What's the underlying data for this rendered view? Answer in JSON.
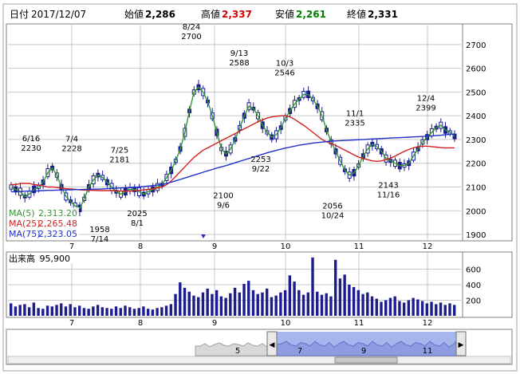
{
  "header": {
    "date_label": "日付",
    "date_value": "2017/12/07",
    "open_label": "始値",
    "open_value": "2,286",
    "high_label": "高値",
    "high_value": "2,337",
    "low_label": "安値",
    "low_value": "2,261",
    "close_label": "終値",
    "close_value": "2,331"
  },
  "legend": {
    "ma5_label": "MA(5)",
    "ma5_value": "2,313.20",
    "ma25_label": "MA(25)",
    "ma25_value": "2,265.48",
    "ma75_label": "MA(75)",
    "ma75_value": "2,323.05"
  },
  "volume": {
    "label": "出来高",
    "value": "95,900"
  },
  "colors": {
    "ma5": "#2e9a2e",
    "ma25": "#d42020",
    "ma75": "#2030c8",
    "candle": "#1c1c8c",
    "high_value": "#d40000",
    "low_value": "#008000",
    "grid": "#c8c8c8",
    "navigator_fill": "#a8b6ee"
  },
  "chart_data": [
    {
      "type": "candlestick",
      "x_axis_labels": [
        "7",
        "8",
        "9",
        "10",
        "11",
        "12"
      ],
      "y_ticks": [
        1900,
        2000,
        2100,
        2200,
        2300,
        2400,
        2500,
        2600,
        2700
      ],
      "ylim": [
        1880,
        2780
      ],
      "annotations": [
        {
          "date": "6/16",
          "value": "2230"
        },
        {
          "date": "7/4",
          "value": "2228"
        },
        {
          "date": "7/25",
          "value": "2181"
        },
        {
          "date": "7/14",
          "value": "1958"
        },
        {
          "date": "8/1",
          "value": "2025"
        },
        {
          "date": "8/24",
          "value": "2700"
        },
        {
          "date": "9/6",
          "value": "2100"
        },
        {
          "date": "9/13",
          "value": "2588"
        },
        {
          "date": "9/22",
          "value": "2253"
        },
        {
          "date": "10/3",
          "value": "2546"
        },
        {
          "date": "10/24",
          "value": "2056"
        },
        {
          "date": "11/1",
          "value": "2335"
        },
        {
          "date": "11/16",
          "value": "2143"
        },
        {
          "date": "12/4",
          "value": "2399"
        }
      ],
      "series": [
        {
          "name": "MA(5)",
          "values": [
            2100,
            2090,
            2080,
            2060,
            2070,
            2090,
            2100,
            2120,
            2160,
            2180,
            2150,
            2100,
            2060,
            2040,
            2020,
            2010,
            2050,
            2100,
            2130,
            2150,
            2140,
            2120,
            2100,
            2080,
            2070,
            2080,
            2090,
            2090,
            2080,
            2070,
            2080,
            2090,
            2100,
            2110,
            2140,
            2170,
            2210,
            2260,
            2330,
            2420,
            2500,
            2520,
            2500,
            2460,
            2400,
            2330,
            2260,
            2240,
            2260,
            2300,
            2350,
            2400,
            2440,
            2430,
            2400,
            2360,
            2330,
            2310,
            2320,
            2350,
            2390,
            2420,
            2450,
            2470,
            2490,
            2490,
            2470,
            2440,
            2400,
            2340,
            2290,
            2250,
            2210,
            2170,
            2150,
            2160,
            2190,
            2230,
            2260,
            2280,
            2270,
            2250,
            2220,
            2210,
            2200,
            2190,
            2190,
            2200,
            2230,
            2260,
            2290,
            2310,
            2330,
            2350,
            2360,
            2340,
            2330,
            2313
          ]
        },
        {
          "name": "MA(25)",
          "values": [
            2110,
            2110,
            2115,
            2115,
            2115,
            2110,
            2108,
            2105,
            2100,
            2100,
            2098,
            2095,
            2093,
            2092,
            2090,
            2088,
            2087,
            2086,
            2086,
            2085,
            2085,
            2085,
            2085,
            2084,
            2083,
            2083,
            2083,
            2084,
            2086,
            2088,
            2090,
            2093,
            2096,
            2100,
            2110,
            2125,
            2145,
            2165,
            2185,
            2205,
            2225,
            2240,
            2255,
            2265,
            2275,
            2285,
            2295,
            2305,
            2315,
            2325,
            2335,
            2345,
            2355,
            2365,
            2375,
            2383,
            2390,
            2395,
            2398,
            2400,
            2400,
            2395,
            2385,
            2372,
            2360,
            2345,
            2330,
            2315,
            2300,
            2290,
            2283,
            2275,
            2265,
            2255,
            2245,
            2235,
            2226,
            2220,
            2215,
            2210,
            2208,
            2210,
            2215,
            2222,
            2230,
            2240,
            2250,
            2258,
            2265,
            2270,
            2272,
            2272,
            2270,
            2268,
            2266,
            2265,
            2265,
            2265
          ]
        },
        {
          "name": "MA(75)",
          "values": [
            2080,
            2080,
            2081,
            2082,
            2083,
            2083,
            2084,
            2085,
            2086,
            2086,
            2087,
            2087,
            2088,
            2088,
            2089,
            2089,
            2090,
            2090,
            2091,
            2091,
            2092,
            2093,
            2094,
            2095,
            2096,
            2097,
            2098,
            2099,
            2100,
            2102,
            2104,
            2106,
            2108,
            2110,
            2115,
            2120,
            2126,
            2132,
            2138,
            2144,
            2150,
            2156,
            2162,
            2168,
            2174,
            2180,
            2185,
            2190,
            2196,
            2202,
            2208,
            2214,
            2220,
            2226,
            2232,
            2238,
            2244,
            2249,
            2254,
            2259,
            2264,
            2268,
            2272,
            2276,
            2279,
            2282,
            2285,
            2287,
            2289,
            2291,
            2293,
            2294,
            2295,
            2296,
            2297,
            2298,
            2299,
            2300,
            2301,
            2302,
            2303,
            2304,
            2305,
            2306,
            2307,
            2308,
            2309,
            2310,
            2311,
            2312,
            2313,
            2314,
            2315,
            2317,
            2318,
            2320,
            2322,
            2323
          ]
        }
      ]
    },
    {
      "type": "bar",
      "title": "出来高",
      "y_ticks": [
        200,
        400,
        600
      ],
      "ylim": [
        0,
        800
      ],
      "x_axis_labels": [
        "7",
        "8",
        "9",
        "10",
        "11",
        "12"
      ],
      "values": [
        160,
        120,
        140,
        150,
        110,
        170,
        100,
        90,
        130,
        120,
        140,
        160,
        120,
        150,
        110,
        130,
        100,
        90,
        120,
        140,
        110,
        100,
        90,
        120,
        100,
        130,
        110,
        90,
        100,
        120,
        90,
        80,
        100,
        110,
        130,
        150,
        280,
        430,
        360,
        310,
        260,
        240,
        300,
        350,
        280,
        330,
        250,
        230,
        290,
        360,
        300,
        410,
        450,
        330,
        280,
        300,
        350,
        240,
        260,
        300,
        330,
        520,
        440,
        330,
        270,
        300,
        750,
        310,
        270,
        290,
        250,
        720,
        480,
        530,
        400,
        370,
        330,
        280,
        300,
        250,
        220,
        180,
        200,
        230,
        250,
        190,
        170,
        200,
        230,
        210,
        190,
        160,
        180,
        150,
        170,
        140,
        160,
        140
      ]
    }
  ],
  "navigator": {
    "labels": [
      "5",
      "7",
      "9",
      "11"
    ],
    "left_arrow": "◀",
    "right_arrow": "▶"
  }
}
